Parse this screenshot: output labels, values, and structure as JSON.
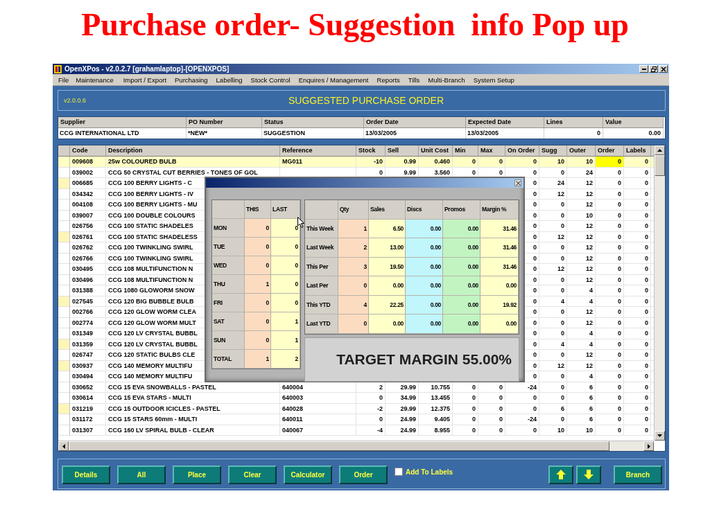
{
  "slide_title": "Purchase order- Suggestion  info Pop up",
  "window": {
    "title": "OpenXPos - v2.0.2.7 [grahamlaptop]-[OPENXPOS]"
  },
  "menu": [
    "File",
    "Maintenance",
    "Import / Export",
    "Purchasing",
    "Labelling",
    "Stock Control",
    "Enquires / Management",
    "Reports",
    "Tills",
    "Multi-Branch",
    "System Setup"
  ],
  "banner": {
    "version": "v2.0.0.6",
    "title": "SUGGESTED PURCHASE ORDER"
  },
  "po_header": {
    "columns": [
      "Supplier",
      "PO Number",
      "Status",
      "Order Date",
      "Expected Date",
      "Lines",
      "Value"
    ],
    "values": [
      "CCG INTERNATIONAL LTD",
      "*NEW*",
      "SUGGESTION",
      "13/03/2005",
      "13/03/2005",
      "0",
      "0.00"
    ]
  },
  "grid": {
    "columns": [
      "Code",
      "Description",
      "Reference",
      "Stock",
      "Sell",
      "Unit Cost",
      "Min",
      "Max",
      "On Order",
      "Sugg",
      "Outer",
      "Order",
      "Labels"
    ],
    "rows": [
      {
        "selected": true,
        "highlighted": true,
        "code": "009608",
        "description": "25w COLOURED BULB",
        "reference": "MG011",
        "stock": "-10",
        "sell": "0.99",
        "unit_cost": "0.460",
        "min": "0",
        "max": "0",
        "on_order": "0",
        "sugg": "10",
        "outer": "10",
        "order": "0",
        "labels": "0"
      },
      {
        "selected": false,
        "highlighted": false,
        "code": "039002",
        "description": "CCG  50 CRYSTAL CUT BERRIES - TONES OF GOL",
        "stock": "0",
        "sell": "9.99",
        "unit_cost": "3.560",
        "min": "0",
        "max": "0",
        "on_order": "0",
        "sugg": "0",
        "outer": "24",
        "order": "0",
        "labels": "0"
      },
      {
        "selected": false,
        "highlighted": true,
        "code": "006685",
        "description": "CCG 100 BERRY LIGHTS - C",
        "on_order": "0",
        "sugg": "24",
        "outer": "12",
        "order": "0",
        "labels": "0"
      },
      {
        "selected": false,
        "highlighted": false,
        "code": "034342",
        "description": "CCG 100 BERRY LIGHTS - IV",
        "on_order": "0",
        "sugg": "12",
        "outer": "12",
        "order": "0",
        "labels": "0"
      },
      {
        "selected": false,
        "highlighted": false,
        "code": "004108",
        "description": "CCG 100 BERRY LIGHTS - MU",
        "on_order": "0",
        "sugg": "0",
        "outer": "12",
        "order": "0",
        "labels": "0"
      },
      {
        "selected": false,
        "highlighted": false,
        "code": "039007",
        "description": "CCG 100 DOUBLE COLOURS",
        "on_order": "0",
        "sugg": "0",
        "outer": "10",
        "order": "0",
        "labels": "0"
      },
      {
        "selected": false,
        "highlighted": false,
        "code": "026756",
        "description": "CCG 100 STATIC SHADELES",
        "on_order": "0",
        "sugg": "0",
        "outer": "12",
        "order": "0",
        "labels": "0"
      },
      {
        "selected": false,
        "highlighted": true,
        "code": "026761",
        "description": "CCG 100 STATIC SHADELESS",
        "on_order": "0",
        "sugg": "12",
        "outer": "12",
        "order": "0",
        "labels": "0"
      },
      {
        "selected": false,
        "highlighted": false,
        "code": "026762",
        "description": "CCG 100 TWINKLING SWIRL",
        "on_order": "0",
        "sugg": "0",
        "outer": "12",
        "order": "0",
        "labels": "0"
      },
      {
        "selected": false,
        "highlighted": false,
        "code": "026766",
        "description": "CCG 100 TWINKLING SWIRL",
        "on_order": "0",
        "sugg": "0",
        "outer": "12",
        "order": "0",
        "labels": "0"
      },
      {
        "selected": false,
        "highlighted": false,
        "code": "030495",
        "description": "CCG 108 MULTIFUNCTION N",
        "on_order": "0",
        "sugg": "12",
        "outer": "12",
        "order": "0",
        "labels": "0"
      },
      {
        "selected": false,
        "highlighted": false,
        "code": "030496",
        "description": "CCG 108 MULTIFUNCTION N",
        "on_order": "0",
        "sugg": "0",
        "outer": "12",
        "order": "0",
        "labels": "0"
      },
      {
        "selected": false,
        "highlighted": false,
        "code": "031388",
        "description": "CCG 1080 GLOWORM SNOW",
        "on_order": "0",
        "sugg": "0",
        "outer": "4",
        "order": "0",
        "labels": "0"
      },
      {
        "selected": false,
        "highlighted": true,
        "code": "027545",
        "description": "CCG 120 BIG BUBBLE BULB",
        "on_order": "0",
        "sugg": "4",
        "outer": "4",
        "order": "0",
        "labels": "0"
      },
      {
        "selected": false,
        "highlighted": false,
        "code": "002766",
        "description": "CCG 120 GLOW WORM CLEA",
        "on_order": "0",
        "sugg": "0",
        "outer": "12",
        "order": "0",
        "labels": "0"
      },
      {
        "selected": false,
        "highlighted": false,
        "code": "002774",
        "description": "CCG 120 GLOW WORM MULT",
        "on_order": "0",
        "sugg": "0",
        "outer": "12",
        "order": "0",
        "labels": "0"
      },
      {
        "selected": false,
        "highlighted": false,
        "code": "031349",
        "description": "CCG 120 LV CRYSTAL BUBBL",
        "on_order": "0",
        "sugg": "0",
        "outer": "4",
        "order": "0",
        "labels": "0"
      },
      {
        "selected": false,
        "highlighted": true,
        "code": "031359",
        "description": "CCG 120 LV CRYSTAL BUBBL",
        "on_order": "0",
        "sugg": "4",
        "outer": "4",
        "order": "0",
        "labels": "0"
      },
      {
        "selected": false,
        "highlighted": false,
        "code": "026747",
        "description": "CCG 120 STATIC BULBS CLE",
        "on_order": "0",
        "sugg": "0",
        "outer": "12",
        "order": "0",
        "labels": "0"
      },
      {
        "selected": false,
        "highlighted": true,
        "code": "030937",
        "description": "CCG 140 MEMORY MULTIFU",
        "on_order": "0",
        "sugg": "12",
        "outer": "12",
        "order": "0",
        "labels": "0"
      },
      {
        "selected": false,
        "highlighted": false,
        "code": "030494",
        "description": "CCG 140 MEMORY MULTIFU",
        "on_order": "0",
        "sugg": "0",
        "outer": "4",
        "order": "0",
        "labels": "0"
      },
      {
        "selected": false,
        "highlighted": false,
        "code": "030652",
        "description": "CCG 15 EVA SNOWBALLS - PASTEL",
        "reference": "640004",
        "stock": "2",
        "sell": "29.99",
        "unit_cost": "10.755",
        "min": "0",
        "max": "0",
        "on_order": "-24",
        "sugg": "0",
        "outer": "6",
        "order": "0",
        "labels": "0"
      },
      {
        "selected": false,
        "highlighted": false,
        "code": "030614",
        "description": "CCG 15 EVA STARS - MULTI",
        "reference": "640003",
        "stock": "0",
        "sell": "34.99",
        "unit_cost": "13.455",
        "min": "0",
        "max": "0",
        "on_order": "0",
        "sugg": "0",
        "outer": "6",
        "order": "0",
        "labels": "0"
      },
      {
        "selected": false,
        "highlighted": true,
        "code": "031219",
        "description": "CCG 15 OUTDOOR ICICLES - PASTEL",
        "reference": "640028",
        "stock": "-2",
        "sell": "29.99",
        "unit_cost": "12.375",
        "min": "0",
        "max": "0",
        "on_order": "0",
        "sugg": "6",
        "outer": "6",
        "order": "0",
        "labels": "0"
      },
      {
        "selected": false,
        "highlighted": false,
        "code": "031172",
        "description": "CCG 15 STARS 60mm - MULTI",
        "reference": "640011",
        "stock": "0",
        "sell": "24.99",
        "unit_cost": "9.405",
        "min": "0",
        "max": "0",
        "on_order": "-24",
        "sugg": "0",
        "outer": "6",
        "order": "0",
        "labels": "0"
      },
      {
        "selected": false,
        "highlighted": false,
        "code": "031307",
        "description": "CCG 160 LV SPIRAL BULB - CLEAR",
        "reference": "040067",
        "stock": "-4",
        "sell": "24.99",
        "unit_cost": "8.955",
        "min": "0",
        "max": "0",
        "on_order": "0",
        "sugg": "10",
        "outer": "10",
        "order": "0",
        "labels": "0"
      }
    ]
  },
  "popup": {
    "days": {
      "columns": [
        "THIS",
        "LAST"
      ],
      "rows": [
        {
          "label": "MON",
          "values": [
            "0",
            "0"
          ]
        },
        {
          "label": "TUE",
          "values": [
            "0",
            "0"
          ]
        },
        {
          "label": "WED",
          "values": [
            "0",
            "0"
          ]
        },
        {
          "label": "THU",
          "values": [
            "1",
            "0"
          ]
        },
        {
          "label": "FRI",
          "values": [
            "0",
            "0"
          ]
        },
        {
          "label": "SAT",
          "values": [
            "0",
            "1"
          ]
        },
        {
          "label": "SUN",
          "values": [
            "0",
            "1"
          ]
        },
        {
          "label": "TOTAL",
          "values": [
            "1",
            "2"
          ]
        }
      ]
    },
    "periods": {
      "columns": [
        "Qty",
        "Sales",
        "Discs",
        "Promos",
        "Margin %"
      ],
      "rows": [
        {
          "label": "This Week",
          "values": [
            "1",
            "6.50",
            "0.00",
            "0.00",
            "31.46"
          ]
        },
        {
          "label": "Last Week",
          "values": [
            "2",
            "13.00",
            "0.00",
            "0.00",
            "31.46"
          ]
        },
        {
          "label": "This Per",
          "values": [
            "3",
            "19.50",
            "0.00",
            "0.00",
            "31.46"
          ]
        },
        {
          "label": "Last Per",
          "values": [
            "0",
            "0.00",
            "0.00",
            "0.00",
            "0.00"
          ]
        },
        {
          "label": "This YTD",
          "values": [
            "4",
            "22.25",
            "0.00",
            "0.00",
            "19.92"
          ]
        },
        {
          "label": "Last YTD",
          "values": [
            "0",
            "0.00",
            "0.00",
            "0.00",
            "0.00"
          ]
        }
      ]
    },
    "target_margin": "TARGET MARGIN 55.00%"
  },
  "toolbar": {
    "buttons": [
      "Details",
      "All",
      "Place",
      "Clear",
      "Calculator",
      "Order"
    ],
    "checkbox": {
      "label": "Add To Labels",
      "checked": false
    },
    "right_button": "Branch"
  }
}
